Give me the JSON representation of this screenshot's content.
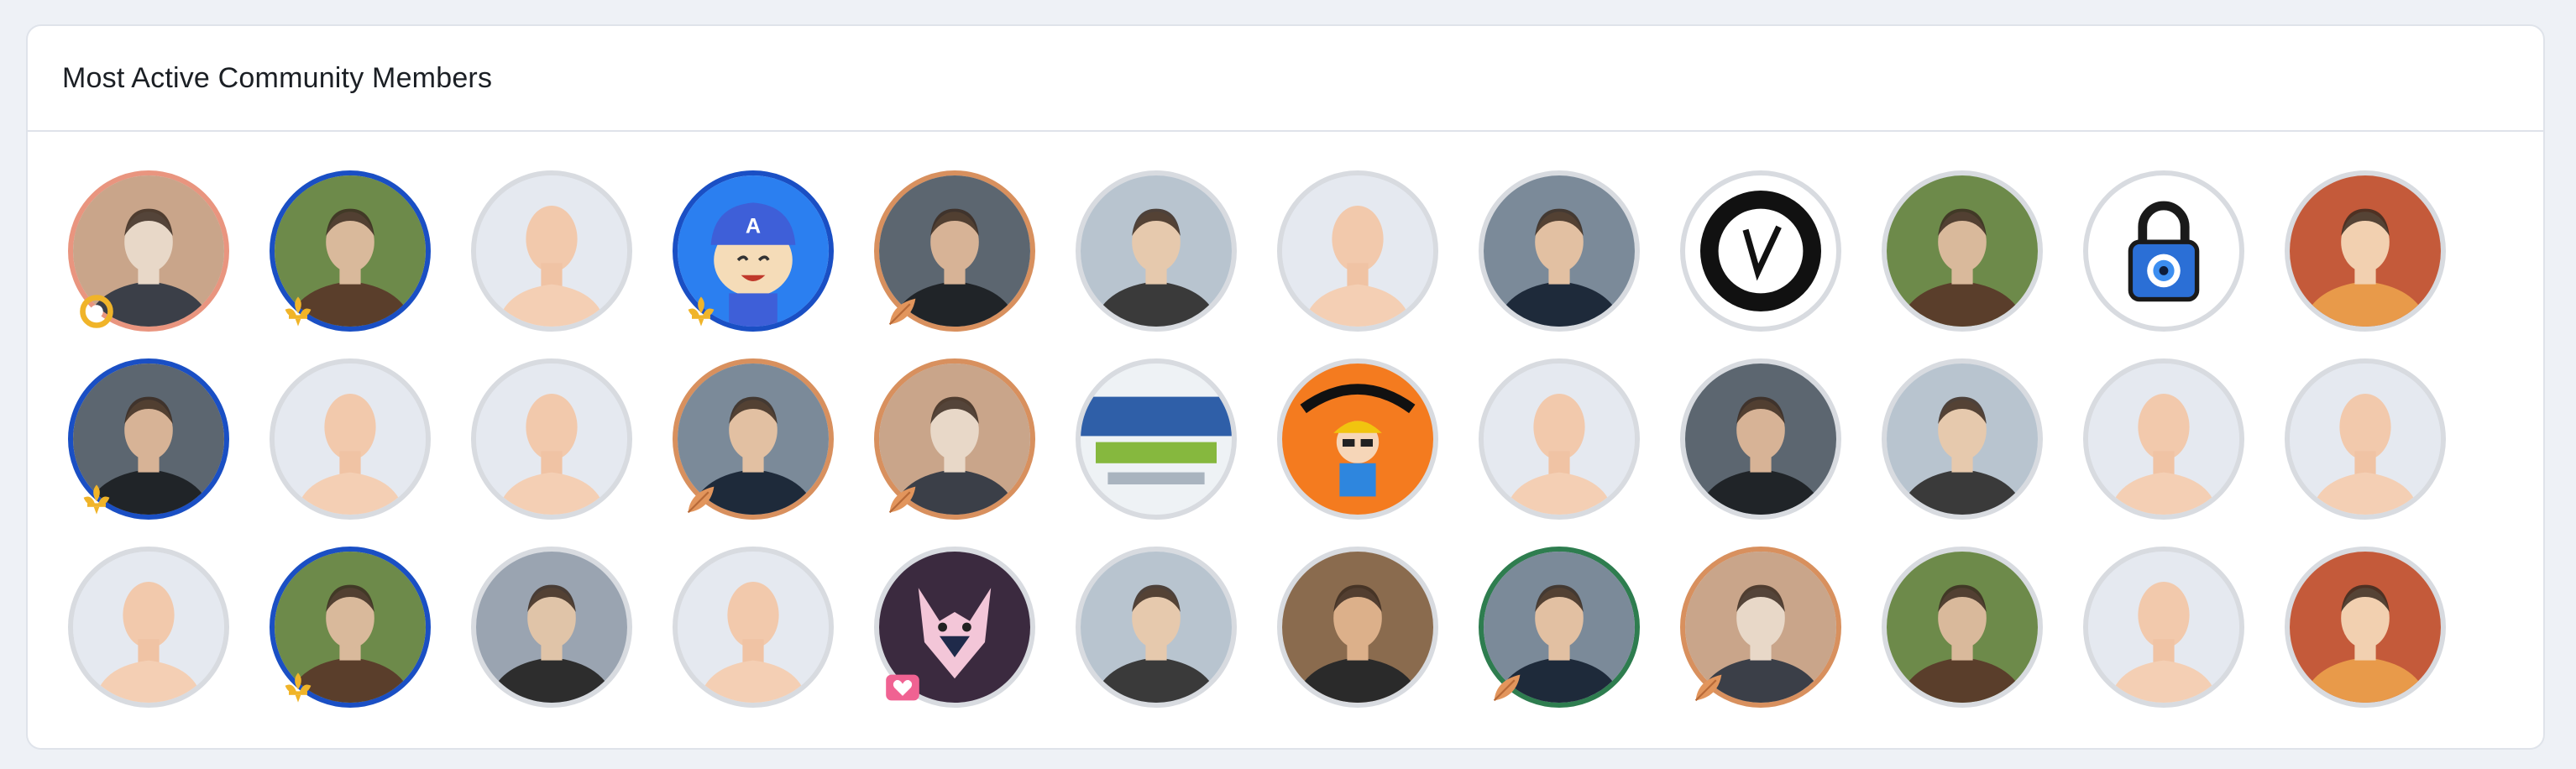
{
  "section": {
    "title": "Most Active Community Members"
  },
  "colors": {
    "ring_blue": "#1a4fc4",
    "ring_orange": "#d8905e",
    "badge_gold": "#f0b429",
    "badge_orange": "#e2955c",
    "badge_pink": "#f06292"
  },
  "members": [
    {
      "ring": "salmon",
      "badge": "gold-ring-badge-icon",
      "avatar": "photo"
    },
    {
      "ring": "blue",
      "badge": "fleur-de-lis-badge-icon",
      "avatar": "photo"
    },
    {
      "ring": "gray",
      "badge": "",
      "avatar": "placeholder-avatar-icon"
    },
    {
      "ring": "blue",
      "badge": "fleur-de-lis-badge-icon",
      "avatar": "cartoon"
    },
    {
      "ring": "orange",
      "badge": "leaf-badge-icon",
      "avatar": "photo"
    },
    {
      "ring": "gray",
      "badge": "",
      "avatar": "photo"
    },
    {
      "ring": "gray",
      "badge": "",
      "avatar": "placeholder-avatar-icon"
    },
    {
      "ring": "gray",
      "badge": "",
      "avatar": "photo"
    },
    {
      "ring": "gray",
      "badge": "",
      "avatar": "logo"
    },
    {
      "ring": "gray",
      "badge": "",
      "avatar": "photo"
    },
    {
      "ring": "gray",
      "badge": "",
      "avatar": "padlock-icon"
    },
    {
      "ring": "gray",
      "badge": "",
      "avatar": "photo"
    },
    {
      "ring": "blue",
      "badge": "fleur-de-lis-badge-icon",
      "avatar": "photo"
    },
    {
      "ring": "gray",
      "badge": "",
      "avatar": "placeholder-avatar-icon"
    },
    {
      "ring": "gray",
      "badge": "",
      "avatar": "placeholder-avatar-icon"
    },
    {
      "ring": "orange",
      "badge": "leaf-badge-icon",
      "avatar": "photo"
    },
    {
      "ring": "orange",
      "badge": "leaf-badge-icon",
      "avatar": "photo"
    },
    {
      "ring": "gray",
      "badge": "",
      "avatar": "logo"
    },
    {
      "ring": "gray",
      "badge": "",
      "avatar": "logo"
    },
    {
      "ring": "gray",
      "badge": "",
      "avatar": "placeholder-avatar-icon"
    },
    {
      "ring": "gray",
      "badge": "",
      "avatar": "photo"
    },
    {
      "ring": "gray",
      "badge": "",
      "avatar": "photo"
    },
    {
      "ring": "gray",
      "badge": "",
      "avatar": "placeholder-avatar-icon"
    },
    {
      "ring": "gray",
      "badge": "",
      "avatar": "placeholder-avatar-icon"
    },
    {
      "ring": "gray",
      "badge": "",
      "avatar": "placeholder-avatar-icon"
    },
    {
      "ring": "blue",
      "badge": "fleur-de-lis-badge-icon",
      "avatar": "photo"
    },
    {
      "ring": "gray",
      "badge": "",
      "avatar": "photo"
    },
    {
      "ring": "gray",
      "badge": "",
      "avatar": "placeholder-avatar-icon"
    },
    {
      "ring": "gray",
      "badge": "heart-badge-icon",
      "avatar": "illustration"
    },
    {
      "ring": "gray",
      "badge": "",
      "avatar": "photo"
    },
    {
      "ring": "gray",
      "badge": "",
      "avatar": "photo"
    },
    {
      "ring": "green",
      "badge": "leaf-badge-icon",
      "avatar": "photo"
    },
    {
      "ring": "orange",
      "badge": "leaf-badge-icon",
      "avatar": "photo"
    },
    {
      "ring": "gray",
      "badge": "",
      "avatar": "photo"
    },
    {
      "ring": "gray",
      "badge": "",
      "avatar": "placeholder-avatar-icon"
    },
    {
      "ring": "gray",
      "badge": "",
      "avatar": "photo"
    }
  ]
}
